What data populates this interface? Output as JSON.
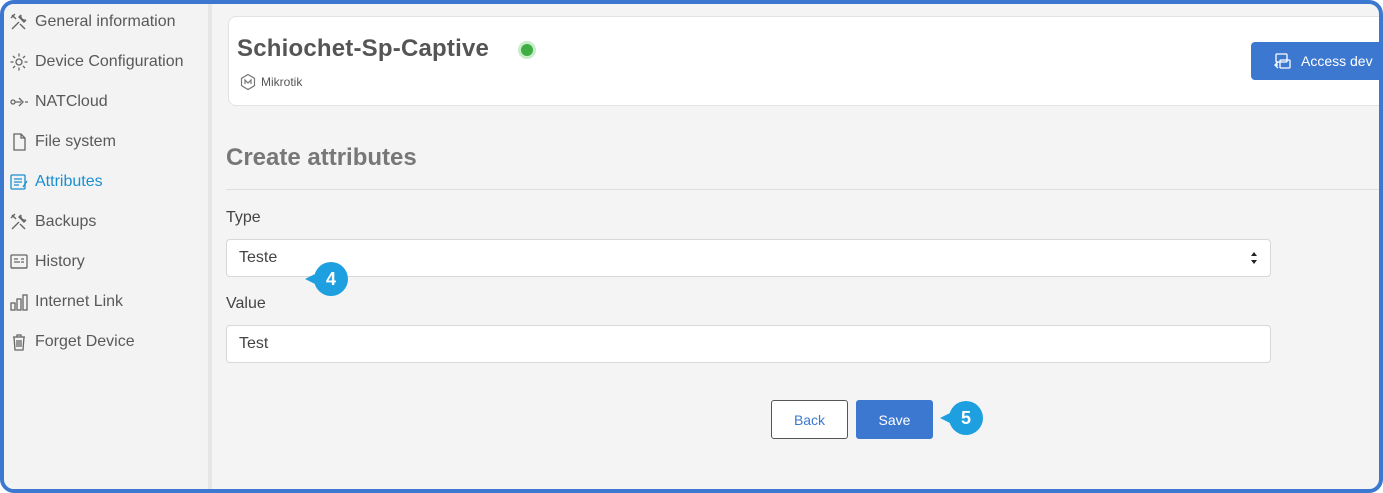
{
  "sidebar": {
    "items": [
      {
        "label": "General information",
        "icon": "tools-icon"
      },
      {
        "label": "Device Configuration",
        "icon": "gear-icon"
      },
      {
        "label": "NATCloud",
        "icon": "natcloud-icon"
      },
      {
        "label": "File system",
        "icon": "file-icon"
      },
      {
        "label": "Attributes",
        "icon": "attributes-icon",
        "active": true
      },
      {
        "label": "Backups",
        "icon": "tools-icon"
      },
      {
        "label": "History",
        "icon": "history-icon"
      },
      {
        "label": "Internet Link",
        "icon": "bar-chart-icon"
      },
      {
        "label": "Forget Device",
        "icon": "trash-icon"
      }
    ]
  },
  "device": {
    "name": "Schiochet-Sp-Captive",
    "status_color": "#3fae45",
    "vendor": "Mikrotik",
    "access_button_label": "Access dev"
  },
  "form": {
    "title": "Create attributes",
    "type_label": "Type",
    "type_value": "Teste",
    "value_label": "Value",
    "value_value": "Test",
    "back_label": "Back",
    "save_label": "Save"
  },
  "callouts": {
    "step_type": "4",
    "step_save": "5"
  },
  "colors": {
    "accent": "#3d78d0",
    "active_nav": "#1a8fd1",
    "callout": "#1ea0e0"
  }
}
